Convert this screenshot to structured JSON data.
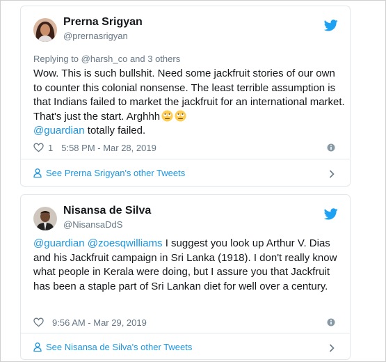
{
  "tweets": [
    {
      "name": "Prerna Srigyan",
      "handle": "@prernasrigyan",
      "reply": "Replying to @harsh_co and 3 others",
      "text_main": "Wow. This is such bullshit. Need some jackfruit stories of our own to counter this colonial nonsense. The least terrible assumption is that Indians failed to market the jackfruit for an international market. That's just the start. Arghhh",
      "mention": "@guardian",
      "text_tail": " totally failed.",
      "likes": "1",
      "time": "5:58 PM - Mar 28, 2019",
      "footer": "See Prerna Srigyan's other Tweets"
    },
    {
      "name": "Nisansa de Silva",
      "handle": "@NisansaDdS",
      "mention1": "@guardian",
      "mention2": "@zoesqwilliams",
      "text_main": " I suggest you look up Arthur V. Dias and his Jackfruit campaign in Sri Lanka (1918). I don't really know what people in Kerala were doing, but I assure you that Jackfruit has been a staple part of Sri Lankan diet for well over a century.",
      "time": "9:56 AM - Mar 29, 2019",
      "footer": "See Nisansa de Silva's other Tweets"
    }
  ],
  "icons": [
    "twitter-bird-icon",
    "heart-icon",
    "info-icon",
    "person-icon",
    "chevron-right-icon",
    "rolling-eyes-emoji"
  ],
  "colors": {
    "link": "#1b95e0",
    "muted": "#657786",
    "text": "#14171a",
    "border": "#e1e8ed"
  }
}
